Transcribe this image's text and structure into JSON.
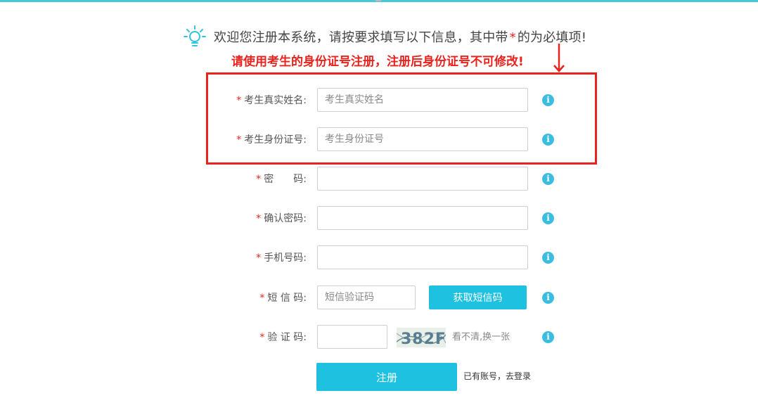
{
  "colors": {
    "accent": "#1ec1e0",
    "warning": "#e8231d",
    "info": "#3bbde0"
  },
  "header": {
    "welcome_before_star": "欢迎您注册本系统，请按要求填写以下信息，其中带",
    "star": "*",
    "welcome_after_star": "的为必填项!",
    "warning": "请使用考生的身份证号注册，注册后身份证号不可修改!"
  },
  "form": {
    "required_mark": "*",
    "info_glyph": "i",
    "name": {
      "label": "考生真实姓名:",
      "placeholder": "考生真实姓名",
      "value": ""
    },
    "idcard": {
      "label": "考生身份证号:",
      "placeholder": "考生身份证号",
      "value": ""
    },
    "password": {
      "label": "密　　码:",
      "placeholder": "",
      "value": ""
    },
    "confirm_password": {
      "label": "确认密码:",
      "placeholder": "",
      "value": ""
    },
    "phone": {
      "label": "手机号码:",
      "placeholder": "",
      "value": ""
    },
    "sms": {
      "label": "短 信 码:",
      "placeholder": "短信验证码",
      "value": "",
      "button": "获取短信码"
    },
    "captcha": {
      "label": "验 证 码:",
      "placeholder": "",
      "value": "",
      "image_text": "382F",
      "refresh": "看不清,换一张"
    }
  },
  "submit": {
    "label": "注册"
  },
  "login_hint": "已有账号，去登录"
}
